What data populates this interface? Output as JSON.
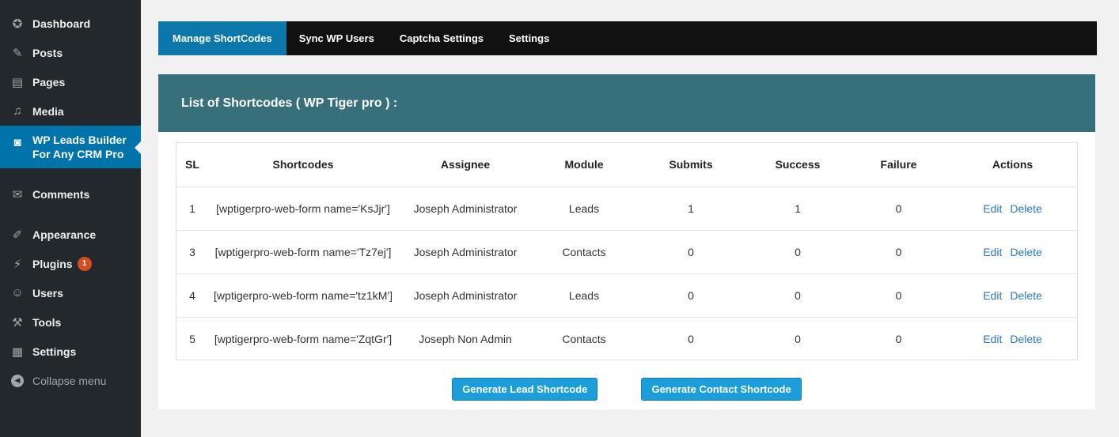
{
  "sidebar": {
    "items": [
      {
        "label": "Dashboard",
        "icon": "dashboard-icon",
        "glyph": "✪"
      },
      {
        "label": "Posts",
        "icon": "pin-icon",
        "glyph": "✎"
      },
      {
        "label": "Pages",
        "icon": "pages-icon",
        "glyph": "▤"
      },
      {
        "label": "Media",
        "icon": "media-icon",
        "glyph": "♫"
      },
      {
        "label": "WP Leads Builder For Any CRM Pro",
        "icon": "camera-icon",
        "glyph": "◙",
        "active": true
      },
      {
        "label": "Comments",
        "icon": "comment-icon",
        "glyph": "✉"
      },
      {
        "label": "Appearance",
        "icon": "brush-icon",
        "glyph": "✐"
      },
      {
        "label": "Plugins",
        "icon": "plug-icon",
        "glyph": "⚡",
        "badge": "1"
      },
      {
        "label": "Users",
        "icon": "user-icon",
        "glyph": "☺"
      },
      {
        "label": "Tools",
        "icon": "wrench-icon",
        "glyph": "⚒"
      },
      {
        "label": "Settings",
        "icon": "settings-icon",
        "glyph": "▦"
      }
    ],
    "collapse_label": "Collapse menu"
  },
  "tabs": [
    {
      "label": "Manage ShortCodes",
      "active": true
    },
    {
      "label": "Sync WP Users"
    },
    {
      "label": "Captcha Settings"
    },
    {
      "label": "Settings"
    }
  ],
  "panel": {
    "title": "List of Shortcodes ( WP Tiger pro ) :"
  },
  "table": {
    "headers": [
      "SL",
      "Shortcodes",
      "Assignee",
      "Module",
      "Submits",
      "Success",
      "Failure",
      "Actions"
    ],
    "rows": [
      {
        "sl": "1",
        "shortcode": "[wptigerpro-web-form name='KsJjr']",
        "assignee": "Joseph Administrator",
        "module": "Leads",
        "submits": "1",
        "success": "1",
        "failure": "0"
      },
      {
        "sl": "3",
        "shortcode": "[wptigerpro-web-form name='Tz7ej']",
        "assignee": "Joseph Administrator",
        "module": "Contacts",
        "submits": "0",
        "success": "0",
        "failure": "0"
      },
      {
        "sl": "4",
        "shortcode": "[wptigerpro-web-form name='tz1kM']",
        "assignee": "Joseph Administrator",
        "module": "Leads",
        "submits": "0",
        "success": "0",
        "failure": "0"
      },
      {
        "sl": "5",
        "shortcode": "[wptigerpro-web-form name='ZqtGr']",
        "assignee": "Joseph Non Admin",
        "module": "Contacts",
        "submits": "0",
        "success": "0",
        "failure": "0"
      }
    ],
    "edit_label": "Edit",
    "delete_label": "Delete"
  },
  "buttons": {
    "lead": "Generate Lead Shortcode",
    "contact": "Generate Contact Shortcode"
  }
}
